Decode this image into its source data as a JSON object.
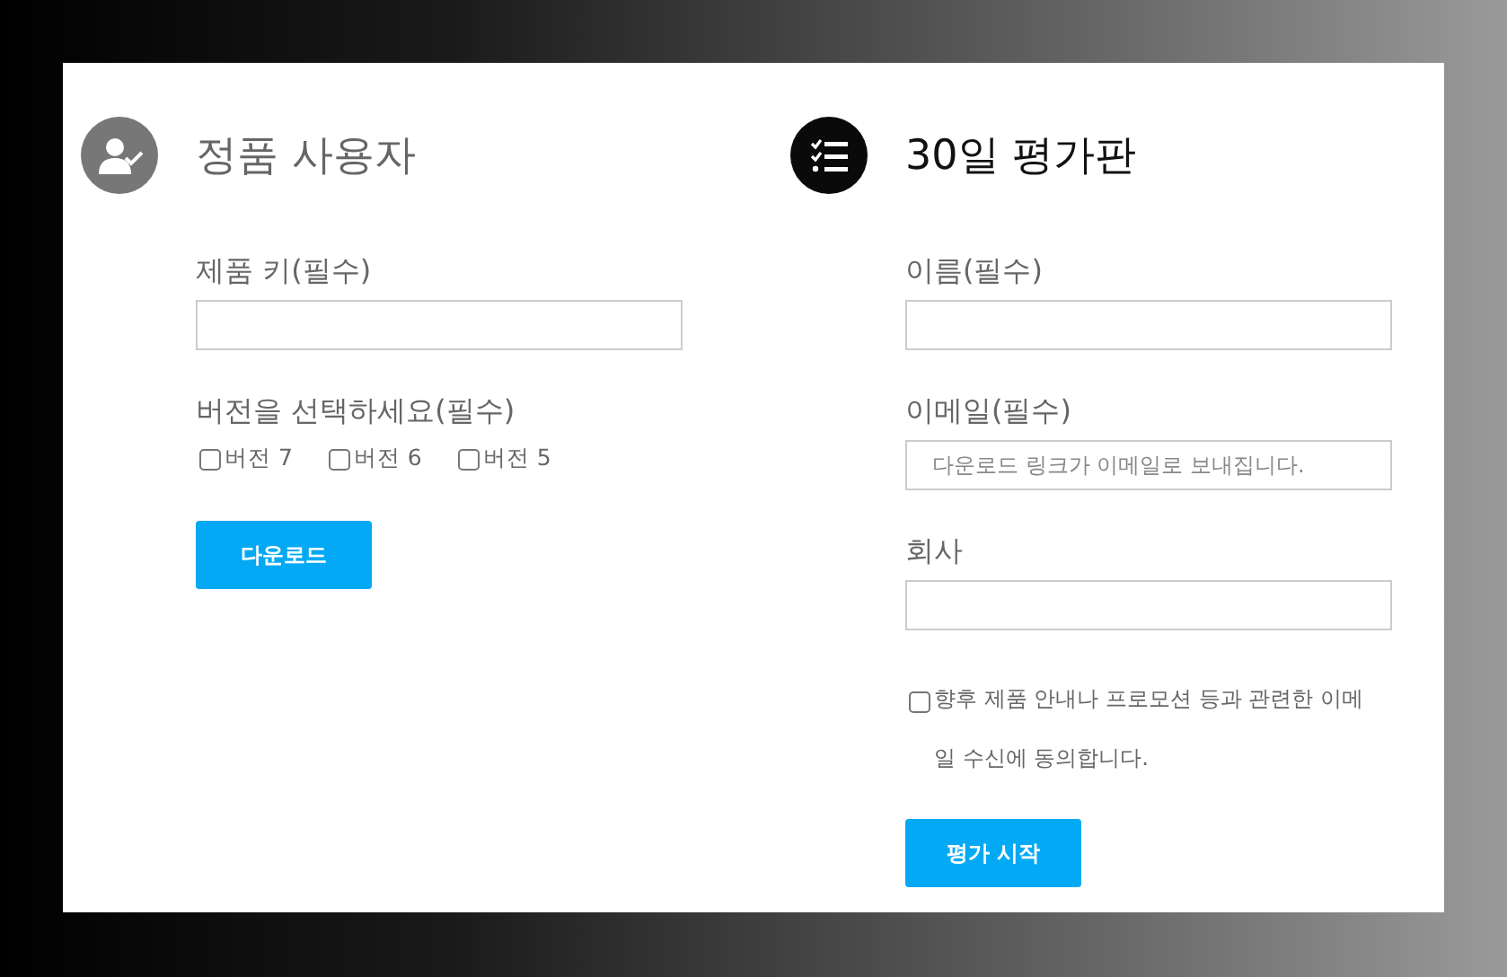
{
  "sections": [
    {
      "kind": "licensed",
      "title": "정품 사용자",
      "emphasized": false,
      "items": [
        {
          "kind": "field",
          "label": "제품 키(필수)",
          "value": ""
        },
        {
          "kind": "checkbox_group",
          "label": "버전을 선택하세요(필수)",
          "options": [
            {
              "label": "버전 7",
              "checked": false
            },
            {
              "label": "버전 6",
              "checked": false
            },
            {
              "label": "버전 5",
              "checked": false
            }
          ]
        }
      ],
      "button": "다운로드"
    },
    {
      "kind": "trial",
      "title": "30일 평가판",
      "emphasized": true,
      "items": [
        {
          "kind": "field",
          "label": "이름(필수)",
          "value": ""
        },
        {
          "kind": "field",
          "label": "이메일(필수)",
          "placeholder": "다운로드 링크가 이메일로 보내집니다."
        },
        {
          "kind": "field",
          "label": "회사",
          "value": ""
        },
        {
          "kind": "consent",
          "label": "향후 제품 안내나 프로모션 등과 관련한 이메일 수신에 동의합니다.",
          "checked": false
        }
      ],
      "button": "평가 시작"
    }
  ]
}
